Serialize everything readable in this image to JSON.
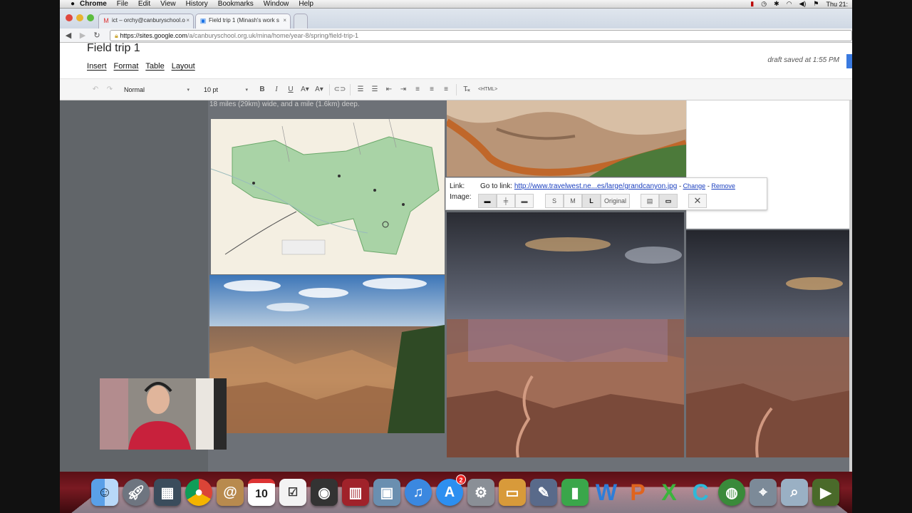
{
  "menubar": {
    "app": "Chrome",
    "items": [
      "File",
      "Edit",
      "View",
      "History",
      "Bookmarks",
      "Window",
      "Help"
    ],
    "clock": "Thu 21:"
  },
  "browser": {
    "tabs": [
      {
        "label": "ict – orchy@canburyschool.o",
        "icon": "gmail-icon"
      },
      {
        "label": "Field trip 1 (Minash's work s",
        "icon": "sites-icon"
      }
    ],
    "url_domain": "https://sites.google.com",
    "url_path": "/a/canburyschool.org.uk/mina/home/year-8/spring/field-trip-1"
  },
  "page": {
    "title": "Field trip 1",
    "draft_status": "draft saved at 1:55 PM",
    "menus": [
      "Insert",
      "Format",
      "Table",
      "Layout"
    ]
  },
  "editor_toolbar": {
    "style": "Normal",
    "font_size": "10 pt",
    "html_label": "<HTML>"
  },
  "content": {
    "caption_text": "18 miles (29km) wide, and a mile (1.6km) deep."
  },
  "link_popup": {
    "link_label": "Link:",
    "image_label": "Image:",
    "goto_label": "Go to link:",
    "url": "http://www.travelwest.ne...es/large/grandcanyon.jpg",
    "change": "Change",
    "remove": "Remove",
    "size_buttons": [
      "S",
      "M",
      "L",
      "Original"
    ],
    "selected_size": "L"
  },
  "dock": {
    "calendar_day": "10",
    "appstore_badge": "2"
  },
  "colors": {
    "accent_blue": "#3a7ae0",
    "link_blue": "#1a3fbf",
    "dock_red": "#6a141b"
  }
}
